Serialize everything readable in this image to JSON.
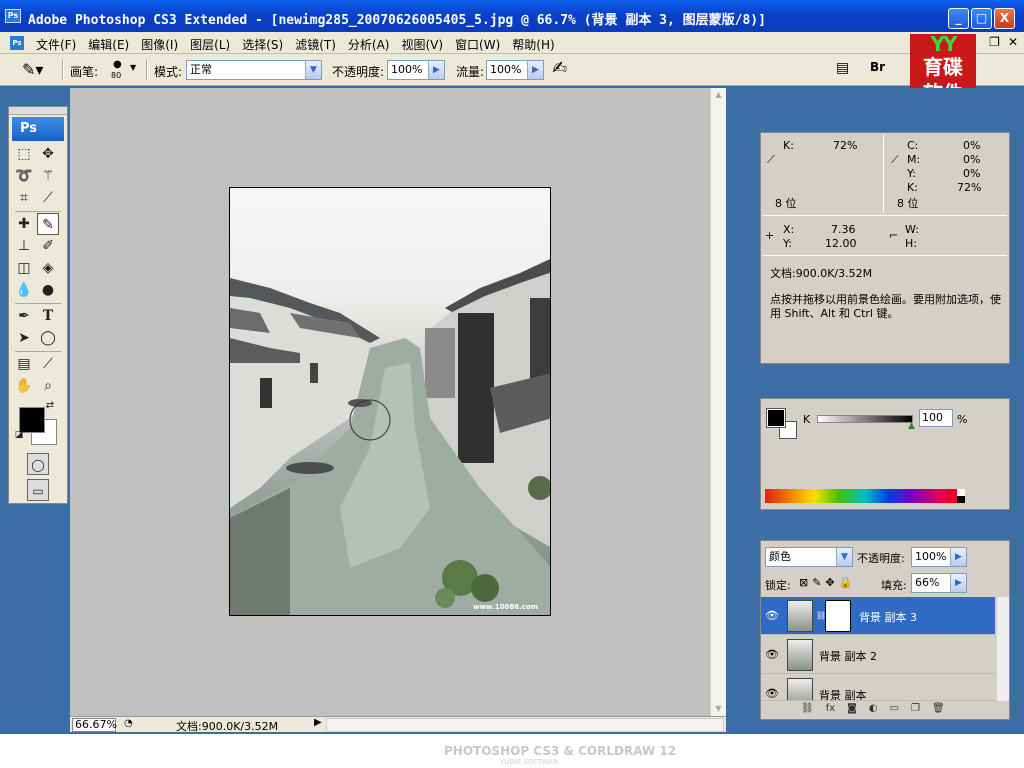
{
  "window": {
    "title": "Adobe Photoshop CS3 Extended - [newimg285_20070626005405_5.jpg @ 66.7% (背景 副本 3, 图层蒙版/8)]",
    "app_icon": "Ps",
    "controls": [
      "_",
      "□",
      "X"
    ]
  },
  "menubar": {
    "items": [
      "文件(F)",
      "编辑(E)",
      "图像(I)",
      "图层(L)",
      "选择(S)",
      "滤镜(T)",
      "分析(A)",
      "视图(V)",
      "窗口(W)",
      "帮助(H)"
    ]
  },
  "options": {
    "brush_label": "画笔:",
    "brush_size": "80",
    "mode_label": "模式:",
    "mode_value": "正常",
    "opacity_label": "不透明度:",
    "opacity_value": "100%",
    "flow_label": "流量:",
    "flow_value": "100%"
  },
  "brand_logo": {
    "top": "YY",
    "line1": "育碟",
    "line2": "软件"
  },
  "toolbox": {
    "badge": "Ps"
  },
  "document": {
    "watermark": "www.10086.com"
  },
  "status": {
    "zoom": "66.67%",
    "doc_info": "文档:900.0K/3.52M"
  },
  "info_panel": {
    "k_label": "K:",
    "k_value": "72%",
    "cmyk": [
      {
        "label": "C:",
        "value": "0%"
      },
      {
        "label": "M:",
        "value": "0%"
      },
      {
        "label": "Y:",
        "value": "0%"
      },
      {
        "label": "K:",
        "value": "72%"
      }
    ],
    "bits_left": "8 位",
    "bits_right": "8 位",
    "x_label": "X:",
    "x_value": "7.36",
    "y_label": "Y:",
    "y_value": "12.00",
    "w_label": "W:",
    "h_label": "H:",
    "doc_size": "文档:900.0K/3.52M",
    "hint": "点按并拖移以用前景色绘画。要用附加选项，使用 Shift、Alt 和 Ctrl 键。"
  },
  "color_panel": {
    "channel_label": "K",
    "value": "100",
    "unit": "%"
  },
  "layers_panel": {
    "blend_mode": "颜色",
    "opacity_label": "不透明度:",
    "opacity_value": "100%",
    "lock_label": "锁定:",
    "fill_label": "填充:",
    "fill_value": "66%",
    "layers": [
      {
        "name": "背景 副本 3",
        "selected": true,
        "has_mask": true
      },
      {
        "name": "背景 副本 2",
        "selected": false,
        "has_mask": false
      },
      {
        "name": "背景 副本",
        "selected": false,
        "has_mask": false
      }
    ]
  },
  "bottom_band": {
    "title": "PHOTOSHOP CS3 & CORLDRAW 12",
    "subtitle": "YUDIE SOFTWAR"
  },
  "colors": {
    "titlebar": "#0a3fc8",
    "selection": "#316ac5",
    "panel_bg": "#d4d0c8",
    "canvas_bg": "#c0c0c0"
  }
}
